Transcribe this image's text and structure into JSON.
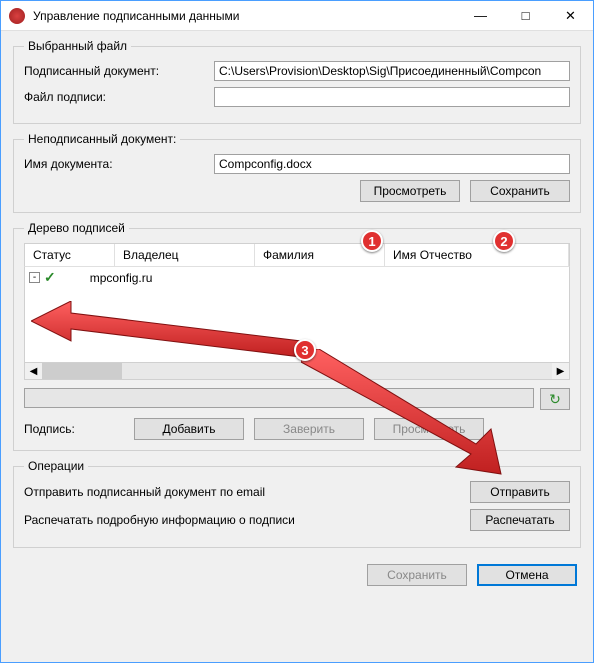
{
  "window": {
    "title": "Управление подписанными данными"
  },
  "selected_file": {
    "legend": "Выбранный файл",
    "signed_doc_label": "Подписанный документ:",
    "signed_doc_value": "C:\\Users\\Provision\\Desktop\\Sig\\Присоединенный\\Compcon",
    "sig_file_label": "Файл подписи:",
    "sig_file_value": ""
  },
  "unsigned_doc": {
    "legend": "Неподписанный документ:",
    "name_label": "Имя документа:",
    "name_value": "Compconfig.docx",
    "view_btn": "Просмотреть",
    "save_btn": "Сохранить"
  },
  "tree": {
    "legend": "Дерево подписей",
    "columns": {
      "status": "Статус",
      "owner": "Владелец",
      "surname": "Фамилия",
      "name_patronymic": "Имя Отчество"
    },
    "rows": [
      {
        "text": "mpconfig.ru"
      }
    ]
  },
  "signature": {
    "label": "Подпись:",
    "add_btn": "Добавить",
    "certify_btn": "Заверить",
    "view_btn": "Просмотреть"
  },
  "operations": {
    "legend": "Операции",
    "email_label": "Отправить подписанный документ по email",
    "email_btn": "Отправить",
    "print_label": "Распечатать подробную информацию о подписи",
    "print_btn": "Распечатать"
  },
  "footer": {
    "save_btn": "Сохранить",
    "cancel_btn": "Отмена"
  },
  "annotations": {
    "b1": "1",
    "b2": "2",
    "b3": "3"
  }
}
